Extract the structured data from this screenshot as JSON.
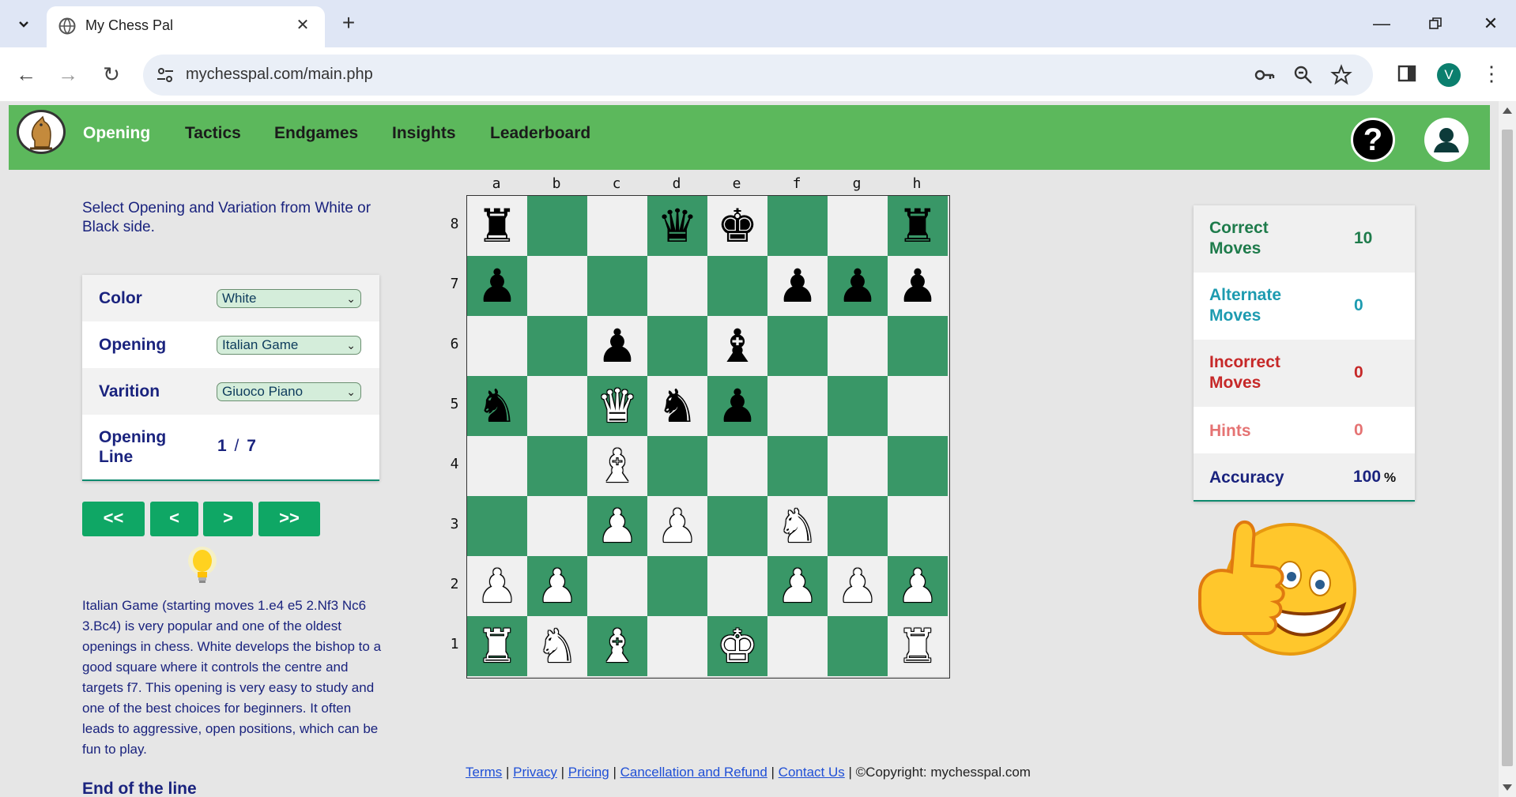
{
  "browser": {
    "tab_title": "My Chess Pal",
    "url": "mychesspal.com/main.php",
    "profile_initial": "V"
  },
  "nav": {
    "items": [
      {
        "label": "Opening",
        "active": true
      },
      {
        "label": "Tactics",
        "active": false
      },
      {
        "label": "Endgames",
        "active": false
      },
      {
        "label": "Insights",
        "active": false
      },
      {
        "label": "Leaderboard",
        "active": false
      }
    ],
    "help_label": "?"
  },
  "left": {
    "intro": "Select Opening and Variation from White or Black side.",
    "color_label": "Color",
    "color_value": "White",
    "opening_label": "Opening",
    "opening_value": "Italian Game",
    "variation_label": "Varition",
    "variation_value": "Giuoco Piano",
    "line_label": "Opening Line",
    "line_current": "1",
    "line_sep": "/",
    "line_total": "7",
    "controls": [
      "<<",
      "<",
      ">",
      ">>"
    ],
    "description": "Italian Game (starting moves 1.e4 e5 2.Nf3 Nc6 3.Bc4) is very popular and one of the oldest openings in chess. White develops the bishop to a good square where it controls the centre and targets f7. This opening is very easy to study and one of the best choices for beginners. It often leads to aggressive, open positions, which can be fun to play.",
    "end_of_line": "End of the line"
  },
  "board": {
    "files": [
      "a",
      "b",
      "c",
      "d",
      "e",
      "f",
      "g",
      "h"
    ],
    "ranks": [
      "8",
      "7",
      "6",
      "5",
      "4",
      "3",
      "2",
      "1"
    ],
    "position": [
      [
        "bR",
        "",
        "",
        "bQ",
        "bK",
        "",
        "",
        "bR"
      ],
      [
        "bP",
        "",
        "",
        "",
        "",
        "bP",
        "bP",
        "bP"
      ],
      [
        "",
        "",
        "bP",
        "",
        "bB",
        "",
        "",
        ""
      ],
      [
        "bN",
        "",
        "wQ",
        "bN",
        "bP",
        "",
        "",
        ""
      ],
      [
        "",
        "",
        "wB",
        "",
        "",
        "",
        "",
        ""
      ],
      [
        "",
        "",
        "wP",
        "wP",
        "",
        "wN",
        "",
        ""
      ],
      [
        "wP",
        "wP",
        "",
        "",
        "",
        "wP",
        "wP",
        "wP"
      ],
      [
        "wR",
        "wN",
        "wB",
        "",
        "wK",
        "",
        "",
        "wR"
      ]
    ],
    "light_color": "#f0f0f0",
    "dark_color": "#399767"
  },
  "stats": {
    "correct_label": "Correct Moves",
    "correct_value": "10",
    "alternate_label": "Alternate Moves",
    "alternate_value": "0",
    "incorrect_label": "Incorrect Moves",
    "incorrect_value": "0",
    "hints_label": "Hints",
    "hints_value": "0",
    "accuracy_label": "Accuracy",
    "accuracy_value": "100",
    "accuracy_unit": "%",
    "colors": {
      "correct": "#1e7b4b",
      "alternate": "#1d9bb0",
      "incorrect": "#c62828",
      "hints": "#e57373",
      "accuracy": "#1a237e"
    }
  },
  "footer": {
    "links": [
      "Terms",
      "Privacy",
      "Pricing",
      "Cancellation and Refund",
      "Contact Us"
    ],
    "copyright": "©Copyright: mychesspal.com"
  },
  "icons": {
    "tab_list": "chevron-down-icon",
    "globe": "globe-icon",
    "close_tab": "close-icon",
    "new_tab": "plus-icon",
    "back": "back-arrow-icon",
    "forward": "forward-arrow-icon",
    "reload": "reload-icon",
    "site_info": "site-settings-icon",
    "password": "key-icon",
    "zoom": "zoom-icon",
    "bookmark": "star-icon",
    "side_panel": "side-panel-icon",
    "menu": "kebab-menu-icon",
    "help": "help-icon",
    "user": "user-icon",
    "hint": "lightbulb-icon",
    "smiley": "thumbs-up-smiley-icon"
  }
}
